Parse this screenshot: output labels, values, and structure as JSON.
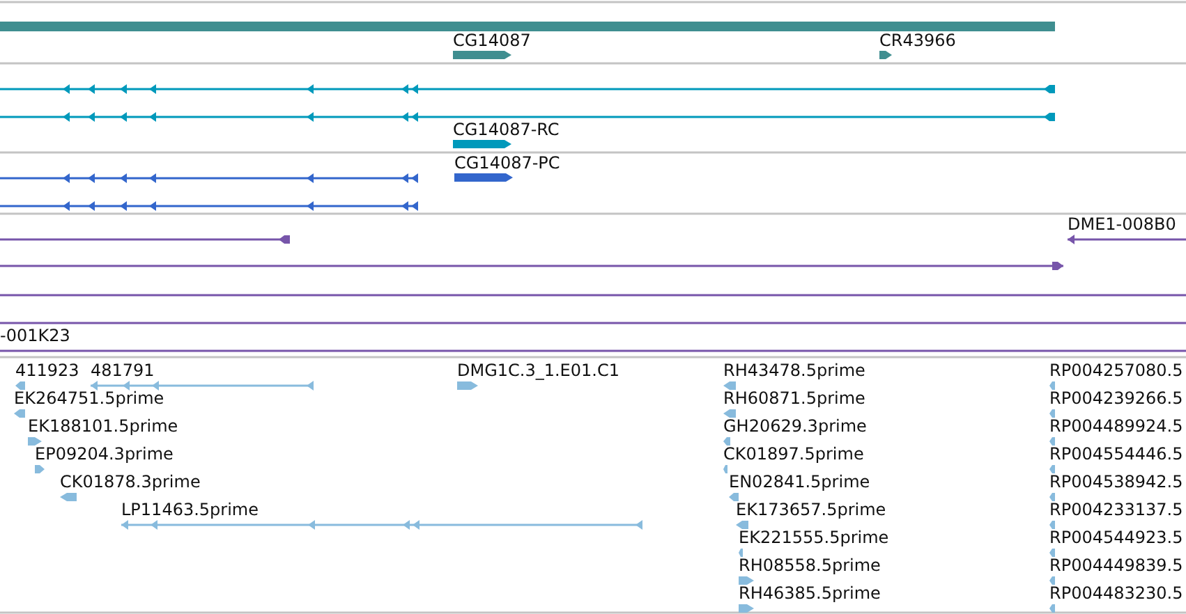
{
  "tracks": [
    {
      "kind": "gene",
      "features": [
        {
          "kind": "bar"
        },
        {
          "kind": "block",
          "label": "CG14087",
          "reverse": false
        },
        {
          "kind": "block",
          "label": "CR43966",
          "reverse": false
        }
      ]
    },
    {
      "kind": "transcript",
      "features": [
        {
          "kind": "line",
          "reverse": true
        },
        {
          "kind": "line",
          "reverse": true
        },
        {
          "kind": "block",
          "label": "CG14087-RC",
          "reverse": false
        }
      ]
    },
    {
      "kind": "protein",
      "features": [
        {
          "kind": "block",
          "label": "CG14087-PC",
          "reverse": false
        },
        {
          "kind": "line",
          "reverse": true
        },
        {
          "kind": "line",
          "reverse": true
        }
      ]
    },
    {
      "kind": "clone",
      "features": [
        {
          "kind": "line",
          "reverse": true
        },
        {
          "kind": "line",
          "label": "DME1-008B0",
          "reverse": true
        },
        {
          "kind": "line",
          "reverse": false
        },
        {
          "kind": "line"
        },
        {
          "kind": "line"
        },
        {
          "kind": "line",
          "label": "-001K23"
        }
      ]
    },
    {
      "kind": "est",
      "features": [
        {
          "kind": "block",
          "label": "411923",
          "reverse": true
        },
        {
          "kind": "line",
          "label": "481791",
          "reverse": true
        },
        {
          "kind": "block",
          "label": "DMG1C.3_1.E01.C1",
          "reverse": false
        },
        {
          "kind": "block",
          "label": "EK264751.5prime",
          "reverse": true
        },
        {
          "kind": "block",
          "label": "EK188101.5prime",
          "reverse": false
        },
        {
          "kind": "block",
          "label": "EP09204.3prime",
          "reverse": false
        },
        {
          "kind": "block",
          "label": "CK01878.3prime",
          "reverse": true
        },
        {
          "kind": "line",
          "label": "LP11463.5prime",
          "reverse": true
        },
        {
          "kind": "block",
          "label": "RH43478.5prime",
          "reverse": true
        },
        {
          "kind": "block",
          "label": "RH60871.5prime",
          "reverse": true
        },
        {
          "kind": "block",
          "label": "GH20629.3prime",
          "reverse": true
        },
        {
          "kind": "block",
          "label": "CK01897.5prime",
          "reverse": true
        },
        {
          "kind": "block",
          "label": "EN02841.5prime",
          "reverse": true
        },
        {
          "kind": "block",
          "label": "EK173657.5prime",
          "reverse": true
        },
        {
          "kind": "block",
          "label": "EK221555.5prime",
          "reverse": true
        },
        {
          "kind": "block",
          "label": "RH08558.5prime",
          "reverse": false
        },
        {
          "kind": "block",
          "label": "RH46385.5prime",
          "reverse": false
        },
        {
          "kind": "block",
          "label": "RP004257080.5",
          "reverse": true
        },
        {
          "kind": "block",
          "label": "RP004239266.5",
          "reverse": true
        },
        {
          "kind": "block",
          "label": "RP004489924.5",
          "reverse": true
        },
        {
          "kind": "block",
          "label": "RP004554446.5",
          "reverse": true
        },
        {
          "kind": "block",
          "label": "RP004538942.5",
          "reverse": true
        },
        {
          "kind": "block",
          "label": "RP004233137.5",
          "reverse": true
        },
        {
          "kind": "block",
          "label": "RP004544923.5",
          "reverse": true
        },
        {
          "kind": "block",
          "label": "RP004449839.5",
          "reverse": true
        },
        {
          "kind": "block",
          "label": "RP004483230.5",
          "reverse": true
        }
      ]
    }
  ]
}
